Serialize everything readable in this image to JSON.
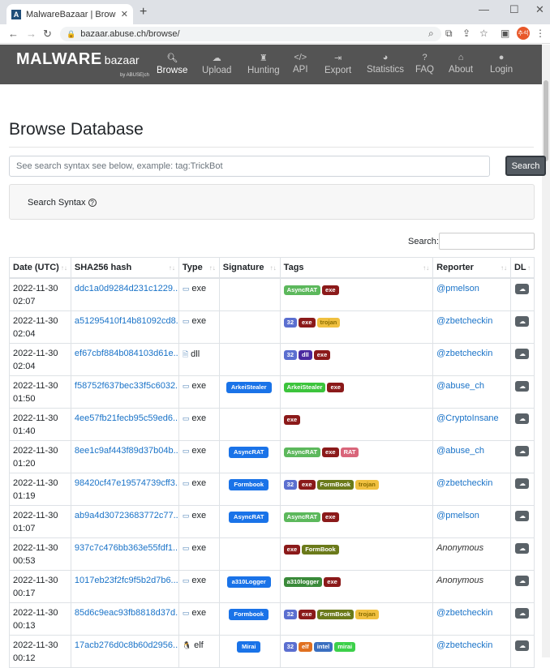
{
  "browser": {
    "tab_title": "MalwareBazaar | Browse malwa",
    "url": "bazaar.abuse.ch/browse/",
    "avatar_text": "추석"
  },
  "site": {
    "logo_big": "MALWARE",
    "logo_small": "bazaar",
    "logo_by": "by ABUSE|ch",
    "nav": [
      {
        "label": "Browse",
        "icon": "search-icon",
        "active": true
      },
      {
        "label": "Upload",
        "icon": "cloud-upload-icon"
      },
      {
        "label": "Hunting",
        "icon": "hunting-icon"
      },
      {
        "label": "API",
        "icon": "code-icon"
      },
      {
        "label": "Export",
        "icon": "export-icon"
      },
      {
        "label": "Statistics",
        "icon": "pie-chart-icon"
      },
      {
        "label": "FAQ",
        "icon": "question-icon"
      },
      {
        "label": "About",
        "icon": "building-icon"
      },
      {
        "label": "Login",
        "icon": "user-icon"
      }
    ]
  },
  "page": {
    "title": "Browse Database",
    "search_placeholder": "See search syntax see below, example: tag:TrickBot",
    "search_button": "Search",
    "syntax_label": "Search Syntax",
    "filter_label": "Search:"
  },
  "table": {
    "headers": [
      "Date (UTC)",
      "SHA256 hash",
      "Type",
      "Signature",
      "Tags",
      "Reporter",
      "DL"
    ],
    "rows": [
      {
        "date": "2022-11-30 02:07",
        "hash": "ddc1a0d9284d231c1229...",
        "type": "exe",
        "sig": "",
        "tags": [
          "AsyncRAT",
          "exe"
        ],
        "reporter": "@pmelson"
      },
      {
        "date": "2022-11-30 02:04",
        "hash": "a51295410f14b81092cd8...",
        "type": "exe",
        "sig": "",
        "tags": [
          "32",
          "exe",
          "trojan"
        ],
        "reporter": "@zbetcheckin"
      },
      {
        "date": "2022-11-30 02:04",
        "hash": "ef67cbf884b084103d61e...",
        "type": "dll",
        "sig": "",
        "tags": [
          "32",
          "dll",
          "exe"
        ],
        "reporter": "@zbetcheckin"
      },
      {
        "date": "2022-11-30 01:50",
        "hash": "f58752f637bec33f5c6032...",
        "type": "exe",
        "sig": "ArkeiStealer",
        "tags": [
          "ArkeiStealer",
          "exe"
        ],
        "reporter": "@abuse_ch"
      },
      {
        "date": "2022-11-30 01:40",
        "hash": "4ee57fb21fecb95c59ed6...",
        "type": "exe",
        "sig": "",
        "tags": [
          "exe"
        ],
        "reporter": "@CryptoInsane"
      },
      {
        "date": "2022-11-30 01:20",
        "hash": "8ee1c9af443f89d37b04b...",
        "type": "exe",
        "sig": "AsyncRAT",
        "tags": [
          "AsyncRAT",
          "exe",
          "RAT"
        ],
        "reporter": "@abuse_ch"
      },
      {
        "date": "2022-11-30 01:19",
        "hash": "98420cf47e19574739cff3...",
        "type": "exe",
        "sig": "Formbook",
        "tags": [
          "32",
          "exe",
          "FormBook",
          "trojan"
        ],
        "reporter": "@zbetcheckin"
      },
      {
        "date": "2022-11-30 01:07",
        "hash": "ab9a4d30723683772c77...",
        "type": "exe",
        "sig": "AsyncRAT",
        "tags": [
          "AsyncRAT",
          "exe"
        ],
        "reporter": "@pmelson"
      },
      {
        "date": "2022-11-30 00:53",
        "hash": "937c7c476bb363e55fdf1...",
        "type": "exe",
        "sig": "",
        "tags": [
          "exe",
          "FormBook"
        ],
        "reporter": "Anonymous"
      },
      {
        "date": "2022-11-30 00:17",
        "hash": "1017eb23f2fc9f5b2d7b6...",
        "type": "exe",
        "sig": "a310Logger",
        "tags": [
          "a310logger",
          "exe"
        ],
        "reporter": "Anonymous"
      },
      {
        "date": "2022-11-30 00:13",
        "hash": "85d6c9eac93fb8818d37d...",
        "type": "exe",
        "sig": "Formbook",
        "tags": [
          "32",
          "exe",
          "FormBook",
          "trojan"
        ],
        "reporter": "@zbetcheckin"
      },
      {
        "date": "2022-11-30 00:12",
        "hash": "17acb276d0c8b60d2956...",
        "type": "elf",
        "sig": "Mirai",
        "tags": [
          "32",
          "elf",
          "intel",
          "mirai"
        ],
        "reporter": "@zbetcheckin"
      }
    ]
  },
  "tag_colors": {
    "AsyncRAT": "#5cb85c",
    "exe": "#8b1a1a",
    "32": "#5b6fd0",
    "trojan": "#f0c040",
    "dll": "#4b2aa0",
    "ArkeiStealer": "#3cc43c",
    "RAT": "#d9657a",
    "FormBook": "#6b7a1a",
    "a310logger": "#3a8a3a",
    "elf": "#e07020",
    "intel": "#3a6fc0",
    "mirai": "#3cd04a"
  }
}
